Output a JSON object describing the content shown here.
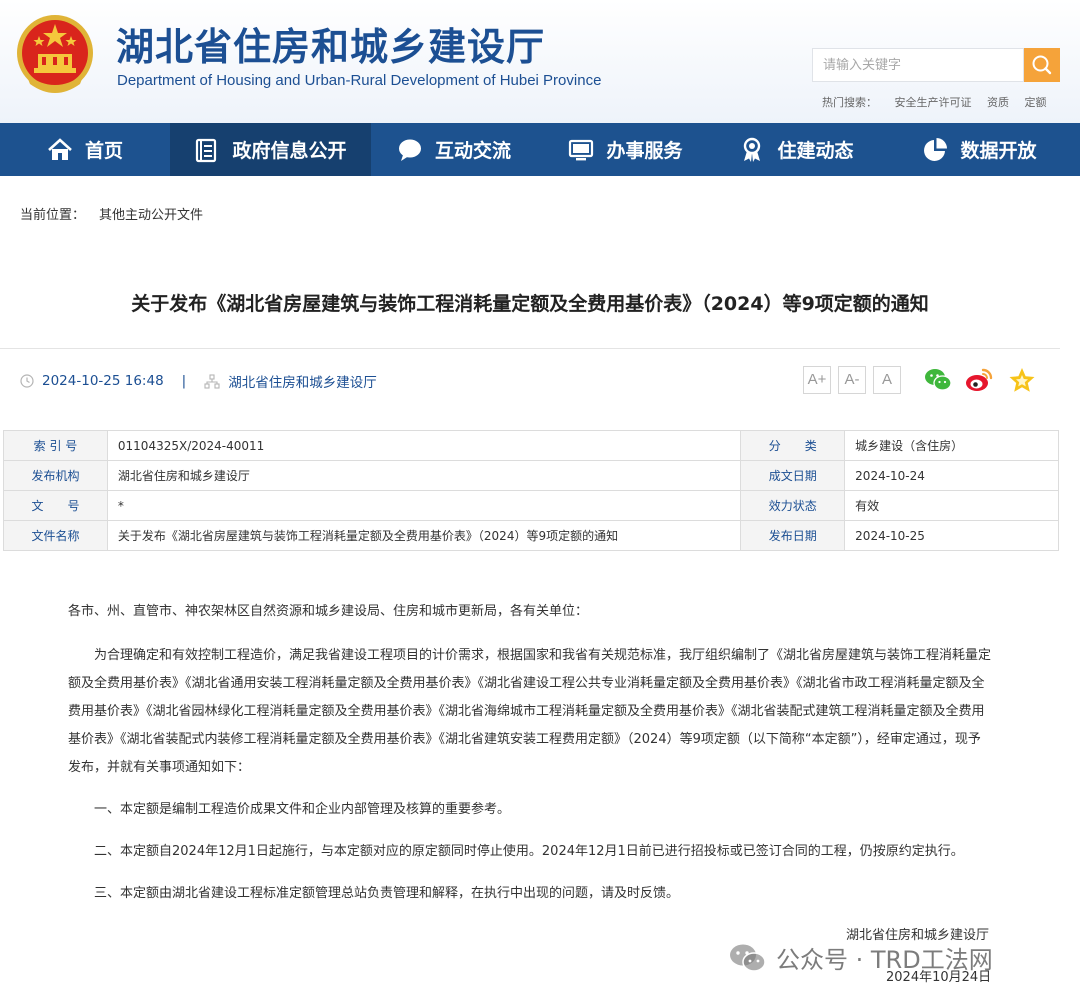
{
  "header": {
    "title": "湖北省住房和城乡建设厅",
    "subtitle": "Department of Housing and Urban-Rural Development of Hubei Province",
    "search_placeholder": "请输入关键字",
    "hot_label": "热门搜索：",
    "hot_keywords": [
      "安全生产许可证",
      "资质",
      "定额"
    ]
  },
  "nav": {
    "items": [
      {
        "label": "首页",
        "icon": "home-icon"
      },
      {
        "label": "政府信息公开",
        "icon": "document-list-icon"
      },
      {
        "label": "互动交流",
        "icon": "chat-bubble-icon"
      },
      {
        "label": "办事服务",
        "icon": "monitor-icon"
      },
      {
        "label": "住建动态",
        "icon": "ribbon-icon"
      },
      {
        "label": "数据开放",
        "icon": "pie-chart-icon"
      }
    ],
    "active_index": 1
  },
  "breadcrumb": {
    "label": "当前位置：",
    "current": "其他主动公开文件"
  },
  "article": {
    "title": "关于发布《湖北省房屋建筑与装饰工程消耗量定额及全费用基价表》（2024）等9项定额的通知",
    "datetime": "2024-10-25 16:48",
    "separator": "|",
    "source": "湖北省住房和城乡建设厅",
    "font_buttons": [
      "A+",
      "A-",
      "A"
    ],
    "share_icons": [
      "wechat-icon",
      "weibo-icon",
      "favorite-star-icon"
    ]
  },
  "info_table": {
    "rows": [
      {
        "l1": "索 引 号",
        "v1": "01104325X/2024-40011",
        "l2": "分　　类",
        "v2": "城乡建设（含住房）"
      },
      {
        "l1": "发布机构",
        "v1": "湖北省住房和城乡建设厅",
        "l2": "成文日期",
        "v2": "2024-10-24"
      },
      {
        "l1": "文　　号",
        "v1": "*",
        "l2": "效力状态",
        "v2": "有效"
      },
      {
        "l1": "文件名称",
        "v1": "关于发布《湖北省房屋建筑与装饰工程消耗量定额及全费用基价表》（2024）等9项定额的通知",
        "l2": "发布日期",
        "v2": "2024-10-25"
      }
    ]
  },
  "body": {
    "greeting": "各市、州、直管市、神农架林区自然资源和城乡建设局、住房和城市更新局，各有关单位：",
    "main": "为合理确定和有效控制工程造价，满足我省建设工程项目的计价需求，根据国家和我省有关规范标准，我厅组织编制了《湖北省房屋建筑与装饰工程消耗量定额及全费用基价表》《湖北省通用安装工程消耗量定额及全费用基价表》《湖北省建设工程公共专业消耗量定额及全费用基价表》《湖北省市政工程消耗量定额及全费用基价表》《湖北省园林绿化工程消耗量定额及全费用基价表》《湖北省海绵城市工程消耗量定额及全费用基价表》《湖北省装配式建筑工程消耗量定额及全费用基价表》《湖北省装配式内装修工程消耗量定额及全费用基价表》《湖北省建筑安装工程费用定额》（2024）等9项定额（以下简称“本定额”），经审定通过，现予发布，并就有关事项通知如下：",
    "items": [
      "一、本定额是编制工程造价成果文件和企业内部管理及核算的重要参考。",
      "二、本定额自2024年12月1日起施行，与本定额对应的原定额同时停止使用。2024年12月1日前已进行招投标或已签订合同的工程，仍按原约定执行。",
      "三、本定额由湖北省建设工程标准定额管理总站负责管理和解释，在执行中出现的问题，请及时反馈。"
    ],
    "signature": "湖北省住房和城乡建设厅",
    "date": "2024年10月24日"
  },
  "watermark": "公众号 · TRD工法网",
  "colors": {
    "brand_blue": "#1c4f93",
    "nav_bg": "#1d528f",
    "nav_active": "#16406f",
    "search_btn": "#f5a33a"
  }
}
